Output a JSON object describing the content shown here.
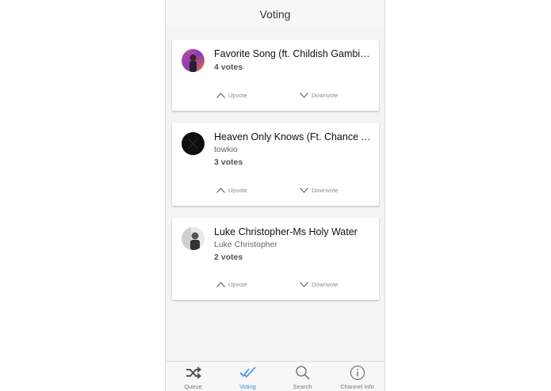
{
  "nav": {
    "title": "Voting"
  },
  "songs": [
    {
      "title": "Favorite Song (ft. Childish Gambino)",
      "artist": "",
      "votes": "4 votes",
      "upvote": "Upvote",
      "downvote": "Downvote"
    },
    {
      "title": "Heaven Only Knows (Ft. Chance The Rapper)",
      "artist": "towkio",
      "votes": "3 votes",
      "upvote": "Upvote",
      "downvote": "Downvote"
    },
    {
      "title": "Luke Christopher-Ms Holy Water",
      "artist": "Luke Christopher",
      "votes": "2 votes",
      "upvote": "Upvote",
      "downvote": "Downvote"
    }
  ],
  "tabs": [
    {
      "label": "Queue",
      "icon": "shuffle-icon"
    },
    {
      "label": "Voting",
      "icon": "double-check-icon"
    },
    {
      "label": "Search",
      "icon": "search-icon"
    },
    {
      "label": "Channel Info",
      "icon": "info-icon"
    }
  ],
  "colors": {
    "accent": "#3a8ee6",
    "inactive": "#777777"
  }
}
